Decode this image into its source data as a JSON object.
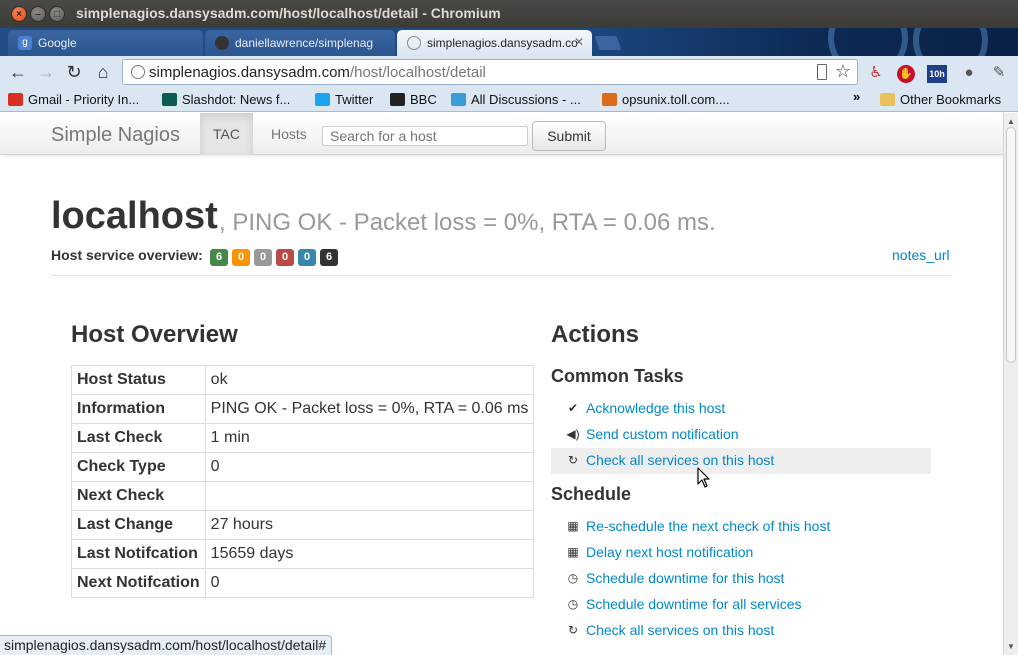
{
  "window": {
    "title": "simplenagios.dansysadm.com/host/localhost/detail - Chromium"
  },
  "tabs": [
    {
      "label": "Google",
      "icon": "google-favicon",
      "active": false
    },
    {
      "label": "daniellawrence/simplenag",
      "icon": "github-favicon",
      "active": false
    },
    {
      "label": "simplenagios.dansysadm.co",
      "icon": "globe-favicon",
      "active": true
    }
  ],
  "omnibox": {
    "host": "simplenagios.dansysadm.com",
    "path": "/host/localhost/detail"
  },
  "bookmarks": [
    {
      "label": "Gmail - Priority In...",
      "icon": "gmail-icon",
      "color": "#d93025"
    },
    {
      "label": "Slashdot: News f...",
      "icon": "slashdot-icon",
      "color": "#0c5b4f"
    },
    {
      "label": "Twitter",
      "icon": "twitter-icon",
      "color": "#1da1f2"
    },
    {
      "label": "BBC",
      "icon": "bbc-icon",
      "color": "#222222"
    },
    {
      "label": "All Discussions - ...",
      "icon": "discussion-icon",
      "color": "#3b9ad8"
    },
    {
      "label": "opsunix.toll.com....",
      "icon": "toll-icon",
      "color": "#d96b1a"
    }
  ],
  "other_bookmarks": "Other Bookmarks",
  "nav": {
    "brand": "Simple Nagios",
    "links": [
      {
        "label": "TAC",
        "active": true
      },
      {
        "label": "Hosts",
        "active": false
      }
    ],
    "search_placeholder": "Search for a host",
    "submit_label": "Submit"
  },
  "host": {
    "name": "localhost",
    "status_text": ", PING OK - Packet loss = 0%, RTA = 0.06 ms.",
    "overview_label": "Host service overview:",
    "badges": [
      {
        "value": "6",
        "color": "#468847"
      },
      {
        "value": "0",
        "color": "#f89406"
      },
      {
        "value": "0",
        "color": "#999999"
      },
      {
        "value": "0",
        "color": "#b94a48"
      },
      {
        "value": "0",
        "color": "#3a87ad"
      },
      {
        "value": "6",
        "color": "#333333"
      }
    ],
    "notes_url": "notes_url"
  },
  "overview": {
    "heading": "Host Overview",
    "rows": [
      {
        "key": "Host Status",
        "value": "ok"
      },
      {
        "key": "Information",
        "value": "PING OK - Packet loss = 0%, RTA = 0.06 ms"
      },
      {
        "key": "Last Check",
        "value": "1 min"
      },
      {
        "key": "Check Type",
        "value": "0"
      },
      {
        "key": "Next Check",
        "value": ""
      },
      {
        "key": "Last Change",
        "value": "27 hours"
      },
      {
        "key": "Last Notifcation",
        "value": "15659 days"
      },
      {
        "key": "Next Notifcation",
        "value": "0"
      }
    ]
  },
  "actions": {
    "heading": "Actions",
    "common_heading": "Common Tasks",
    "common": [
      {
        "label": "Acknowledge this host",
        "icon": "checkmark-icon"
      },
      {
        "label": "Send custom notification",
        "icon": "speaker-icon"
      },
      {
        "label": "Check all services on this host",
        "icon": "refresh-icon"
      }
    ],
    "schedule_heading": "Schedule",
    "schedule": [
      {
        "label": "Re-schedule the next check of this host",
        "icon": "calendar-icon"
      },
      {
        "label": "Delay next host notification",
        "icon": "calendar-icon"
      },
      {
        "label": "Schedule downtime for this host",
        "icon": "clock-icon"
      },
      {
        "label": "Schedule downtime for all services",
        "icon": "clock-icon"
      },
      {
        "label": "Check all services on this host",
        "icon": "refresh-icon"
      }
    ]
  },
  "status_bar": "simplenagios.dansysadm.com/host/localhost/detail#"
}
